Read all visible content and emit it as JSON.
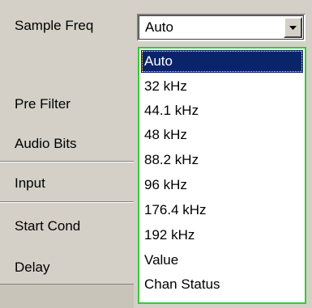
{
  "settings": {
    "sample_freq_label": "Sample Freq",
    "pre_filter_label": "Pre Filter",
    "audio_bits_label": "Audio Bits",
    "input_label": "Input",
    "start_cond_label": "Start Cond",
    "delay_label": "Delay"
  },
  "combo": {
    "value": "Auto"
  },
  "dropdown": {
    "options": [
      "Auto",
      "32 kHz",
      "44.1 kHz",
      "48 kHz",
      "88.2 kHz",
      "96 kHz",
      "176.4 kHz",
      "192 kHz",
      "Value",
      "Chan Status"
    ],
    "selected": "Auto"
  }
}
